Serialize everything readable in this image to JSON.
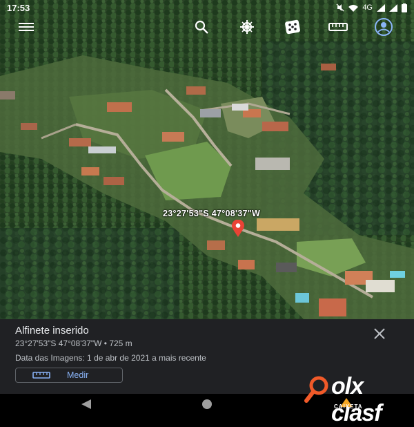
{
  "status_bar": {
    "time": "17:53",
    "network": "4G"
  },
  "toolbar": {
    "menu_icon": "hamburger-menu-icon",
    "search_icon": "search-icon",
    "voyager_icon": "voyager-wheel-icon",
    "feeling_lucky_icon": "dice-icon",
    "measure_icon": "ruler-icon",
    "account_icon": "account-icon"
  },
  "map": {
    "coordinates_label": "23°27'53\"S 47°08'37\"W"
  },
  "panel": {
    "title": "Alfinete inserido",
    "coordinates": "23°27'53\"S 47°08'37\"W • 725 m",
    "imagery_date": "Data das Imagens: 1 de abr de 2021 a mais recente",
    "measure_label": "Medir",
    "close_icon": "close-icon"
  },
  "navigation": {
    "back": "back-triangle-icon",
    "home": "home-circle-icon"
  },
  "watermark": {
    "text": "olx clasf",
    "brand": "CAIXETA"
  },
  "colors": {
    "panel_bg": "#202124",
    "accent": "#8ab4f8",
    "pin": "#ea4335",
    "forest": "#2d4a2a"
  }
}
